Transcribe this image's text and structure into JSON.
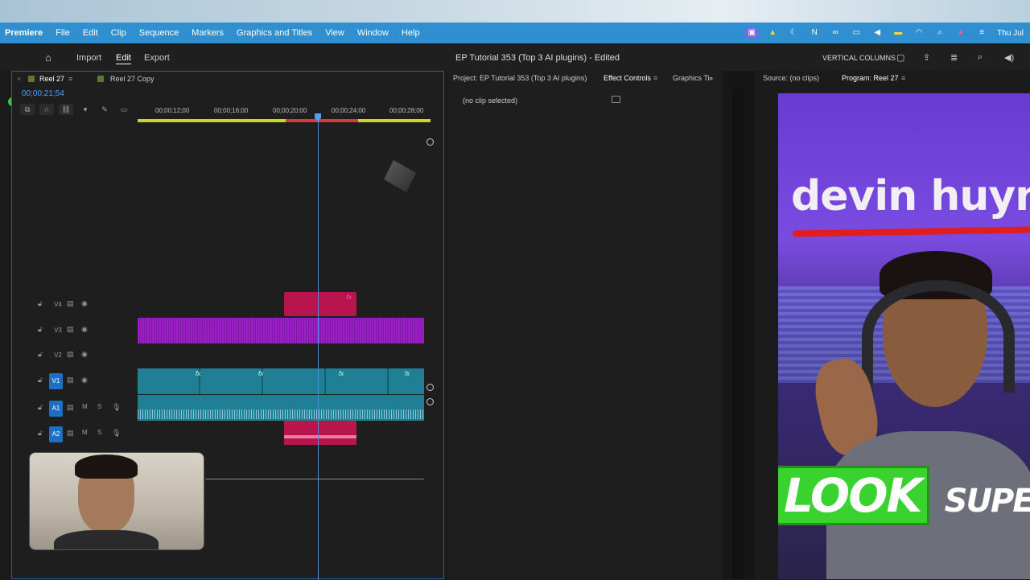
{
  "menubar": {
    "app_name": "Premiere",
    "items": [
      "File",
      "Edit",
      "Clip",
      "Sequence",
      "Markers",
      "Graphics and Titles",
      "View",
      "Window",
      "Help"
    ],
    "clock": "Thu Jul"
  },
  "header": {
    "tabs": [
      "Import",
      "Edit",
      "Export"
    ],
    "active_tab": "Edit",
    "project_title": "EP Tutorial 353 (Top 3 AI plugins) - Edited",
    "workspace": "VERTICAL COLUMNS"
  },
  "timeline": {
    "tabs": [
      "Reel 27",
      "Reel 27 Copy"
    ],
    "timecode": "00;00;21;54",
    "ruler_labels": [
      "00;00;12;00",
      "00;00;16;00",
      "00;00;20;00",
      "00;00;24;00",
      "00;00;28;00"
    ],
    "tracks": [
      {
        "name": "V4",
        "targeted": false
      },
      {
        "name": "V3",
        "targeted": false
      },
      {
        "name": "V2",
        "targeted": false
      },
      {
        "name": "V1",
        "targeted": true
      },
      {
        "name": "A1",
        "targeted": true
      },
      {
        "name": "A2",
        "targeted": true
      }
    ],
    "fx_label": "fx",
    "mute_label": "M",
    "solo_label": "S"
  },
  "effects_panel": {
    "tabs": [
      "Project: EP Tutorial 353 (Top 3 AI plugins)",
      "Effect Controls",
      "Graphics Ti"
    ],
    "active_tab": "Effect Controls",
    "empty_message": "(no clip selected)"
  },
  "monitor": {
    "tabs": [
      "Source: (no clips)",
      "Program: Reel 27"
    ],
    "active_tab": "Program: Reel 27",
    "overlay_name": "devin huynl",
    "overlay_look": "LOOK",
    "overlay_super": "SUPE"
  },
  "colors": {
    "accent": "#2f8fd0",
    "playhead": "#4aa3ff",
    "clip_pink": "#b8154f",
    "clip_purple": "#9a1fc4",
    "clip_teal": "#1f7f95"
  }
}
